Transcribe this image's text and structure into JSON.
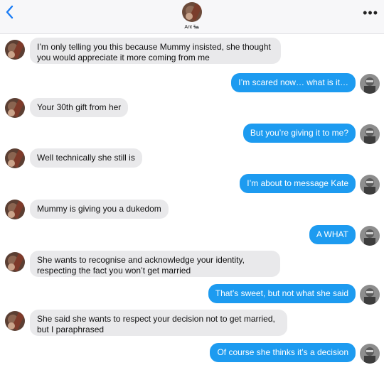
{
  "header": {
    "contact_name": "Ant 🐜",
    "more_label": "•••"
  },
  "colors": {
    "incoming_bubble": "#e9e9eb",
    "outgoing_bubble": "#1d9bf0",
    "back_chevron": "#1a7cf5"
  },
  "messages": [
    {
      "from": "Ant",
      "text": "I’m only telling you this because Mummy insisted, she thought you would appreciate it more coming from me"
    },
    {
      "from": "me",
      "text": "I’m scared now… what is it…"
    },
    {
      "from": "Ant",
      "text": "Your 30th gift from her"
    },
    {
      "from": "me",
      "text": "But you’re giving it to me?"
    },
    {
      "from": "Ant",
      "text": "Well technically she still is"
    },
    {
      "from": "me",
      "text": "I’m about to message Kate"
    },
    {
      "from": "Ant",
      "text": "Mummy is giving you a dukedom"
    },
    {
      "from": "me",
      "text": "A WHAT"
    },
    {
      "from": "Ant",
      "text": "She wants to recognise and acknowledge your identity, respecting the fact you won’t get married"
    },
    {
      "from": "me",
      "text": "That’s sweet, but not what she said"
    },
    {
      "from": "Ant",
      "text": "She said she wants to respect your decision not to get married, but I paraphrased"
    },
    {
      "from": "me",
      "text": "Of course she thinks it’s a decision"
    }
  ]
}
